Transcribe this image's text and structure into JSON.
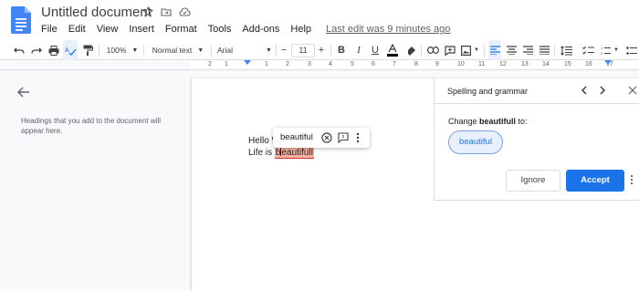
{
  "document": {
    "title": "Untitled document",
    "last_edit": "Last edit was 9 minutes ago"
  },
  "menu": [
    "File",
    "Edit",
    "View",
    "Insert",
    "Format",
    "Tools",
    "Add-ons",
    "Help"
  ],
  "toolbar": {
    "zoom": "100%",
    "style": "Normal text",
    "font": "Arial",
    "font_size": "11",
    "minus": "−",
    "plus": "+"
  },
  "ruler": {
    "left_labels": [
      "2",
      "1"
    ],
    "right_labels": [
      "1",
      "2",
      "3",
      "4",
      "5",
      "6",
      "7",
      "8",
      "9",
      "10",
      "11",
      "12",
      "13",
      "14",
      "15",
      "16",
      "17"
    ]
  },
  "outline": {
    "placeholder": "Headings that you add to the document will appear here."
  },
  "body": {
    "line1": "Hello W",
    "line2_prefix": "Life is ",
    "misspelled_before_cursor": "b",
    "misspelled_after_cursor": "eautifull"
  },
  "popup": {
    "suggestion": "beautiful"
  },
  "spelling_panel": {
    "title": "Spelling and grammar",
    "change_prefix": "Change ",
    "misspelled_word": "beautifull",
    "change_suffix": " to:",
    "suggestion": "beautiful",
    "ignore_label": "Ignore",
    "accept_label": "Accept"
  },
  "colors": {
    "accent": "#1a73e8",
    "misspelling_highlight": "#f4b3a2",
    "docs_blue": "#4285f4"
  }
}
